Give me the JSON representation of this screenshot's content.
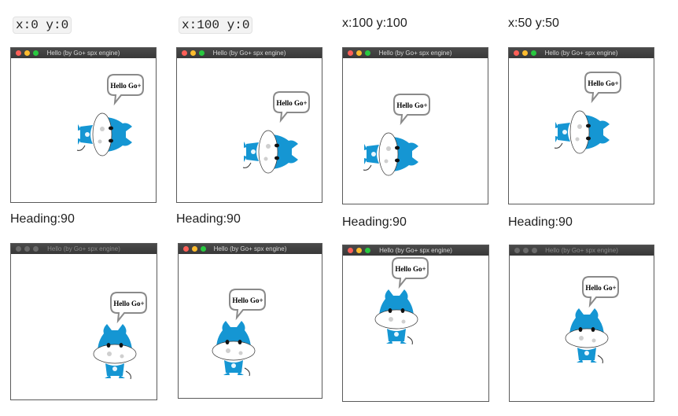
{
  "top_labels": [
    "x:0 y:0",
    "x:100 y:0",
    "x:100 y:100",
    "x:50 y:50"
  ],
  "heading_labels": [
    "Heading:90",
    "Heading:90",
    "Heading:90",
    "Heading:90"
  ],
  "window": {
    "title": "Hello (by Go+ spx engine)",
    "speech": "Hello Go+"
  },
  "colors": {
    "cow_blue": "#1596d3",
    "title_bar": "#3c3c3c",
    "bubble_border": "#8a8a8a"
  }
}
